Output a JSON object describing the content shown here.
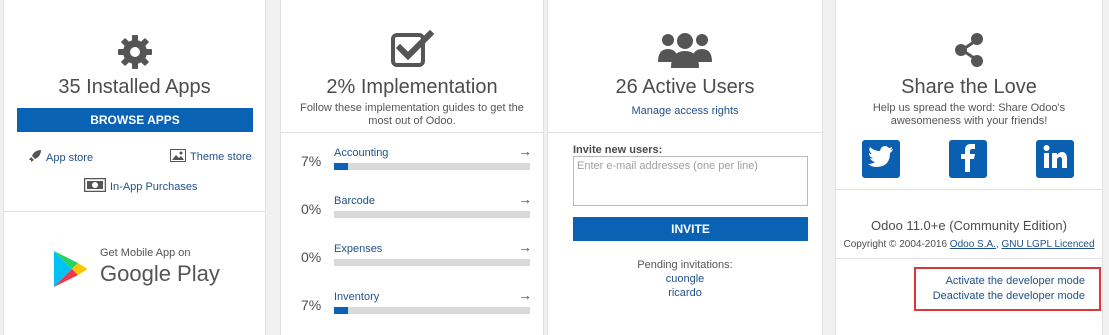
{
  "apps": {
    "title": "35 Installed Apps",
    "browse_label": "BROWSE APPS",
    "app_store": "App store",
    "theme_store": "Theme store",
    "in_app": "In-App Purchases",
    "mobile_get": "Get Mobile App on",
    "mobile_store": "Google Play"
  },
  "implementation": {
    "title": "2% Implementation",
    "subtitle": "Follow these implementation guides to get the most out of Odoo.",
    "guides": [
      {
        "pct": "7%",
        "name": "Accounting",
        "progress": 0.07
      },
      {
        "pct": "0%",
        "name": "Barcode",
        "progress": 0.0
      },
      {
        "pct": "0%",
        "name": "Expenses",
        "progress": 0.0
      },
      {
        "pct": "7%",
        "name": "Inventory",
        "progress": 0.07
      }
    ]
  },
  "users": {
    "title": "26 Active Users",
    "manage_link": "Manage access rights",
    "invite_label": "Invite new users:",
    "invite_placeholder": "Enter e-mail addresses (one per line)",
    "invite_button": "INVITE",
    "pending_label": "Pending invitations:",
    "pending": [
      "cuongle",
      "ricardo"
    ]
  },
  "share": {
    "title": "Share the Love",
    "subtitle": "Help us spread the word: Share Odoo's awesomeness with your friends!",
    "twitter_icon": "twitter-icon",
    "facebook_icon": "facebook-icon",
    "linkedin_icon": "linkedin-icon"
  },
  "version": {
    "title": "Odoo 11.0+e (Community Edition)",
    "copyright_prefix": "Copyright © 2004-2016",
    "company_link": "Odoo S.A.",
    "licence_link": "GNU LGPL Licenced"
  },
  "developer": {
    "activate": "Activate the developer mode",
    "deactivate": "Deactivate the developer mode"
  },
  "colors": {
    "primary": "#0a62b5",
    "link": "#21528a",
    "highlight_border": "#d9363e"
  }
}
